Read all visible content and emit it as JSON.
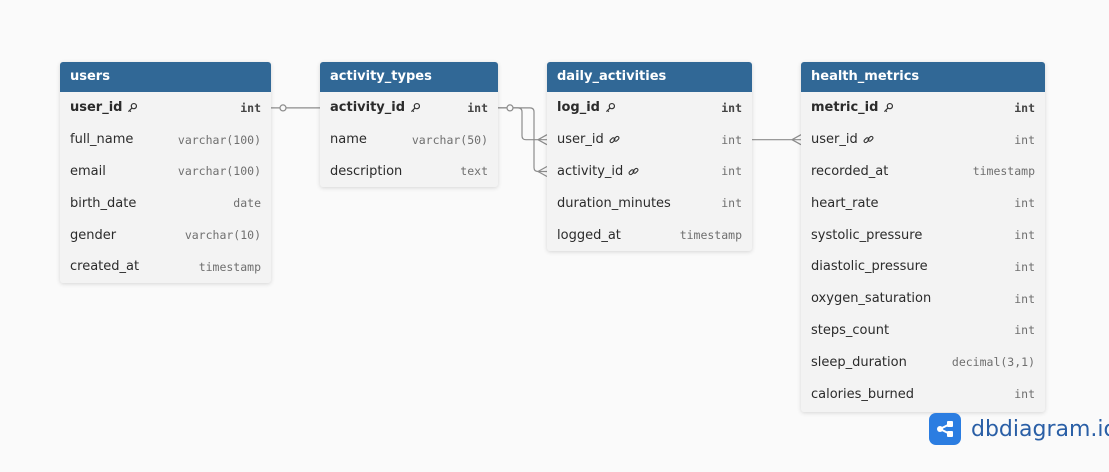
{
  "tables": [
    {
      "name": "users",
      "fields": [
        {
          "name": "user_id",
          "type": "int",
          "key": "pk"
        },
        {
          "name": "full_name",
          "type": "varchar(100)",
          "key": ""
        },
        {
          "name": "email",
          "type": "varchar(100)",
          "key": ""
        },
        {
          "name": "birth_date",
          "type": "date",
          "key": ""
        },
        {
          "name": "gender",
          "type": "varchar(10)",
          "key": ""
        },
        {
          "name": "created_at",
          "type": "timestamp",
          "key": ""
        }
      ]
    },
    {
      "name": "activity_types",
      "fields": [
        {
          "name": "activity_id",
          "type": "int",
          "key": "pk"
        },
        {
          "name": "name",
          "type": "varchar(50)",
          "key": ""
        },
        {
          "name": "description",
          "type": "text",
          "key": ""
        }
      ]
    },
    {
      "name": "daily_activities",
      "fields": [
        {
          "name": "log_id",
          "type": "int",
          "key": "pk"
        },
        {
          "name": "user_id",
          "type": "int",
          "key": "fk"
        },
        {
          "name": "activity_id",
          "type": "int",
          "key": "fk"
        },
        {
          "name": "duration_minutes",
          "type": "int",
          "key": ""
        },
        {
          "name": "logged_at",
          "type": "timestamp",
          "key": ""
        }
      ]
    },
    {
      "name": "health_metrics",
      "fields": [
        {
          "name": "metric_id",
          "type": "int",
          "key": "pk"
        },
        {
          "name": "user_id",
          "type": "int",
          "key": "fk"
        },
        {
          "name": "recorded_at",
          "type": "timestamp",
          "key": ""
        },
        {
          "name": "heart_rate",
          "type": "int",
          "key": ""
        },
        {
          "name": "systolic_pressure",
          "type": "int",
          "key": ""
        },
        {
          "name": "diastolic_pressure",
          "type": "int",
          "key": ""
        },
        {
          "name": "oxygen_saturation",
          "type": "int",
          "key": ""
        },
        {
          "name": "steps_count",
          "type": "int",
          "key": ""
        },
        {
          "name": "sleep_duration",
          "type": "decimal(3,1)",
          "key": ""
        },
        {
          "name": "calories_burned",
          "type": "int",
          "key": ""
        }
      ]
    }
  ],
  "relationships": [
    {
      "from_table": "users",
      "from_field": "user_id",
      "to_table": "daily_activities",
      "to_field": "user_id",
      "cardinality": "one-to-many"
    },
    {
      "from_table": "activity_types",
      "from_field": "activity_id",
      "to_table": "daily_activities",
      "to_field": "activity_id",
      "cardinality": "one-to-many"
    },
    {
      "from_table": "daily_activities",
      "from_field": "user_id",
      "to_table": "health_metrics",
      "to_field": "user_id",
      "cardinality": "one-to-many"
    }
  ],
  "brand": {
    "name": "dbdiagram.io",
    "icon": "share-nodes-icon"
  },
  "colors": {
    "header": "#316896",
    "body": "#f3f3f3",
    "line": "#8c8c8c",
    "brand": "#2b7de1"
  }
}
